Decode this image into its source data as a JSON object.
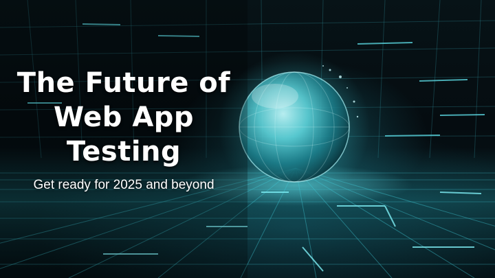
{
  "banner": {
    "title_lines": [
      "The Future of",
      "Web App",
      "Testing"
    ],
    "subtitle": "Get ready for 2025 and beyond"
  },
  "colors": {
    "accent": "#3fd0dc",
    "background": "#050c10",
    "text": "#ffffff"
  },
  "imagery": {
    "background": "digital-grid-tunnel",
    "focal_object": "glass-sphere"
  }
}
